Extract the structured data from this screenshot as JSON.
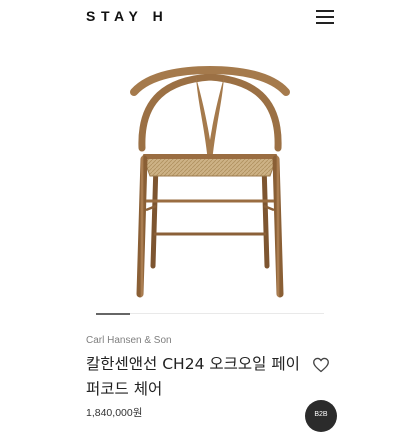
{
  "header": {
    "logo": "STAY H",
    "menu_icon": "hamburger-menu-icon"
  },
  "gallery": {
    "image_subject": "wishbone-chair-photo",
    "progress_fraction": 0.15
  },
  "product": {
    "brand": "Carl Hansen & Son",
    "name": "칼한센앤선 CH24 오크오일 페이퍼코드 체어",
    "price": "1,840,000원",
    "wishlist_icon": "heart-outline-icon"
  },
  "floating": {
    "b2b_label": "B2B"
  },
  "colors": {
    "text": "#222222",
    "muted": "#7f7f7f",
    "wood": "#a57a4c",
    "seat": "#c7ab7d",
    "button": "#2b2b2b"
  }
}
